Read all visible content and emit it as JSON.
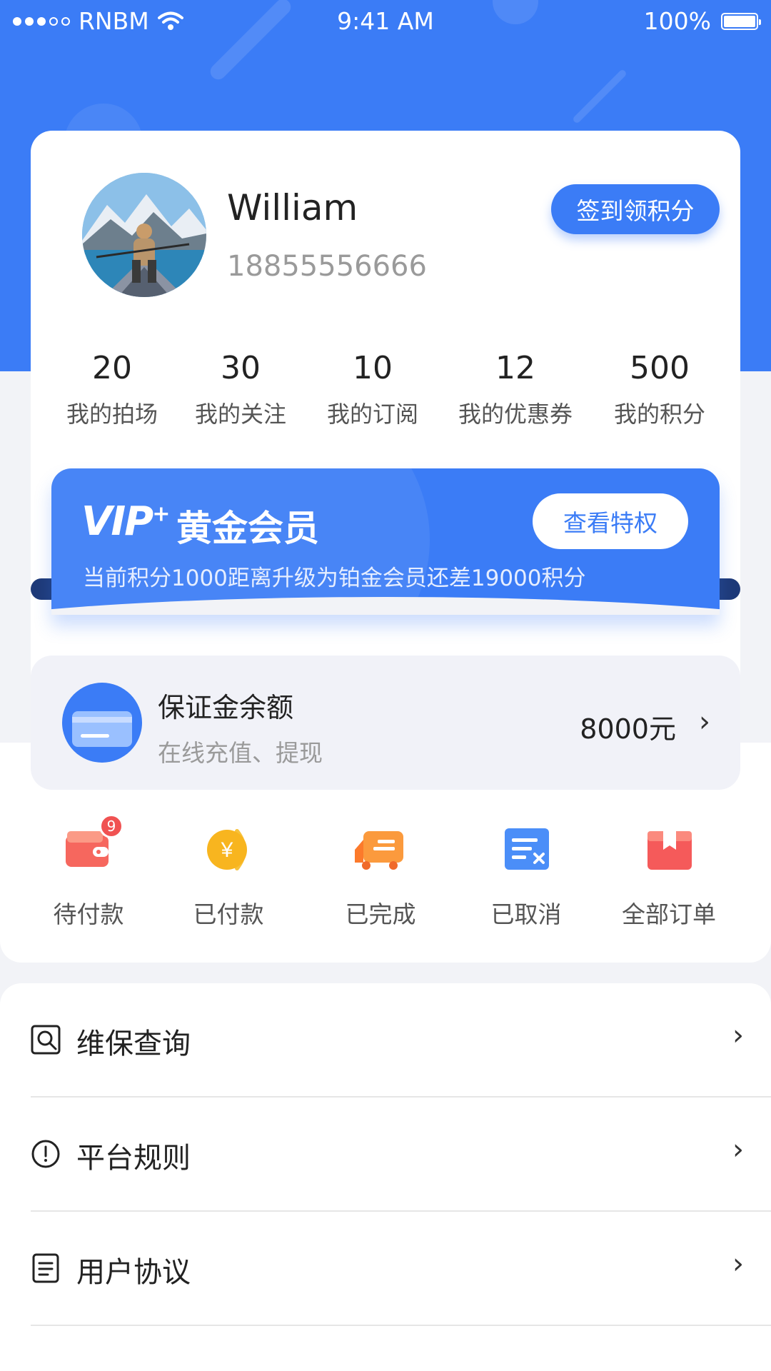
{
  "status_bar": {
    "carrier": "RNBM",
    "time": "9:41 AM",
    "battery_text": "100%",
    "icons": [
      "signal-icon",
      "wifi-icon",
      "battery-icon"
    ]
  },
  "profile": {
    "name": "William",
    "phone": "18855556666",
    "signin_label": "签到领积分"
  },
  "stats": [
    {
      "value": "20",
      "label": "我的拍场"
    },
    {
      "value": "30",
      "label": "我的关注"
    },
    {
      "value": "10",
      "label": "我的订阅"
    },
    {
      "value": "12",
      "label": "我的优惠券"
    },
    {
      "value": "500",
      "label": "我的积分"
    }
  ],
  "vip": {
    "logo": "VIP",
    "title": "黄金会员",
    "button": "查看特权",
    "desc": "当前积分1000距离升级为铂金会员还差19000积分"
  },
  "deposit": {
    "title": "保证金余额",
    "subtitle": "在线充值、提现",
    "amount": "8000元",
    "arrow": "›"
  },
  "orders": [
    {
      "label": "待付款",
      "icon": "wallet-icon",
      "badge": "9"
    },
    {
      "label": "已付款",
      "icon": "yen-coin-icon"
    },
    {
      "label": "已完成",
      "icon": "delivery-truck-icon"
    },
    {
      "label": "已取消",
      "icon": "cancel-doc-icon"
    },
    {
      "label": "全部订单",
      "icon": "box-icon"
    }
  ],
  "menu": [
    {
      "label": "维保查询",
      "icon": "search-doc-icon",
      "arrow": "›"
    },
    {
      "label": "平台规则",
      "icon": "info-icon",
      "arrow": "›"
    },
    {
      "label": "用户协议",
      "icon": "document-icon",
      "arrow": "›"
    }
  ],
  "colors": {
    "primary": "#3b7cf6",
    "background": "#f2f3f7",
    "badge": "#f05252"
  }
}
